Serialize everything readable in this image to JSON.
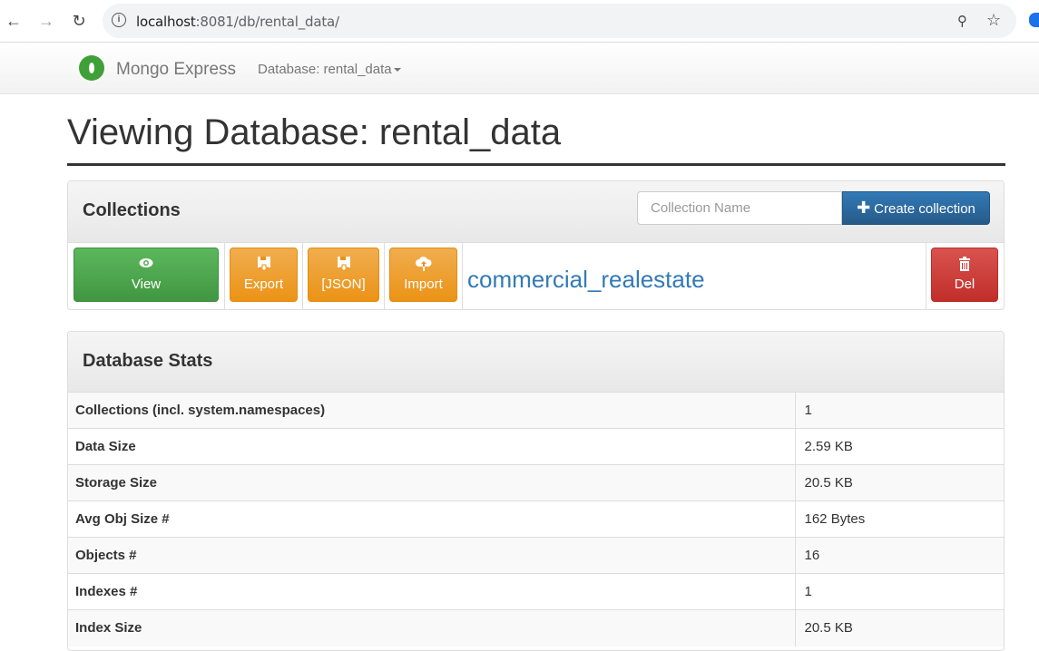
{
  "browser": {
    "url_host": "localhost",
    "url_rest": ":8081/db/rental_data/"
  },
  "navbar": {
    "brand": "Mongo Express",
    "database_dropdown": "Database: rental_data"
  },
  "page": {
    "title": "Viewing Database: rental_data"
  },
  "collections_panel": {
    "title": "Collections",
    "input_placeholder": "Collection Name",
    "create_button": "Create collection",
    "rows": [
      {
        "view": "View",
        "export": "Export",
        "json": "[JSON]",
        "import": "Import",
        "name": "commercial_realestate",
        "del": "Del"
      }
    ]
  },
  "stats_panel": {
    "title": "Database Stats",
    "rows": [
      {
        "key": "Collections (incl. system.namespaces)",
        "value": "1"
      },
      {
        "key": "Data Size",
        "value": "2.59 KB"
      },
      {
        "key": "Storage Size",
        "value": "20.5 KB"
      },
      {
        "key": "Avg Obj Size #",
        "value": "162 Bytes"
      },
      {
        "key": "Objects #",
        "value": "16"
      },
      {
        "key": "Indexes #",
        "value": "1"
      },
      {
        "key": "Index Size",
        "value": "20.5 KB"
      }
    ]
  },
  "colors": {
    "primary": "#337ab7",
    "success": "#5cb85c",
    "warning": "#f0ad4e",
    "danger": "#d9534f"
  },
  "icons": {
    "view": "eye-icon",
    "export": "save-icon",
    "json": "save-icon",
    "import": "cloud-upload-icon",
    "del": "trash-icon",
    "create": "plus-icon"
  }
}
